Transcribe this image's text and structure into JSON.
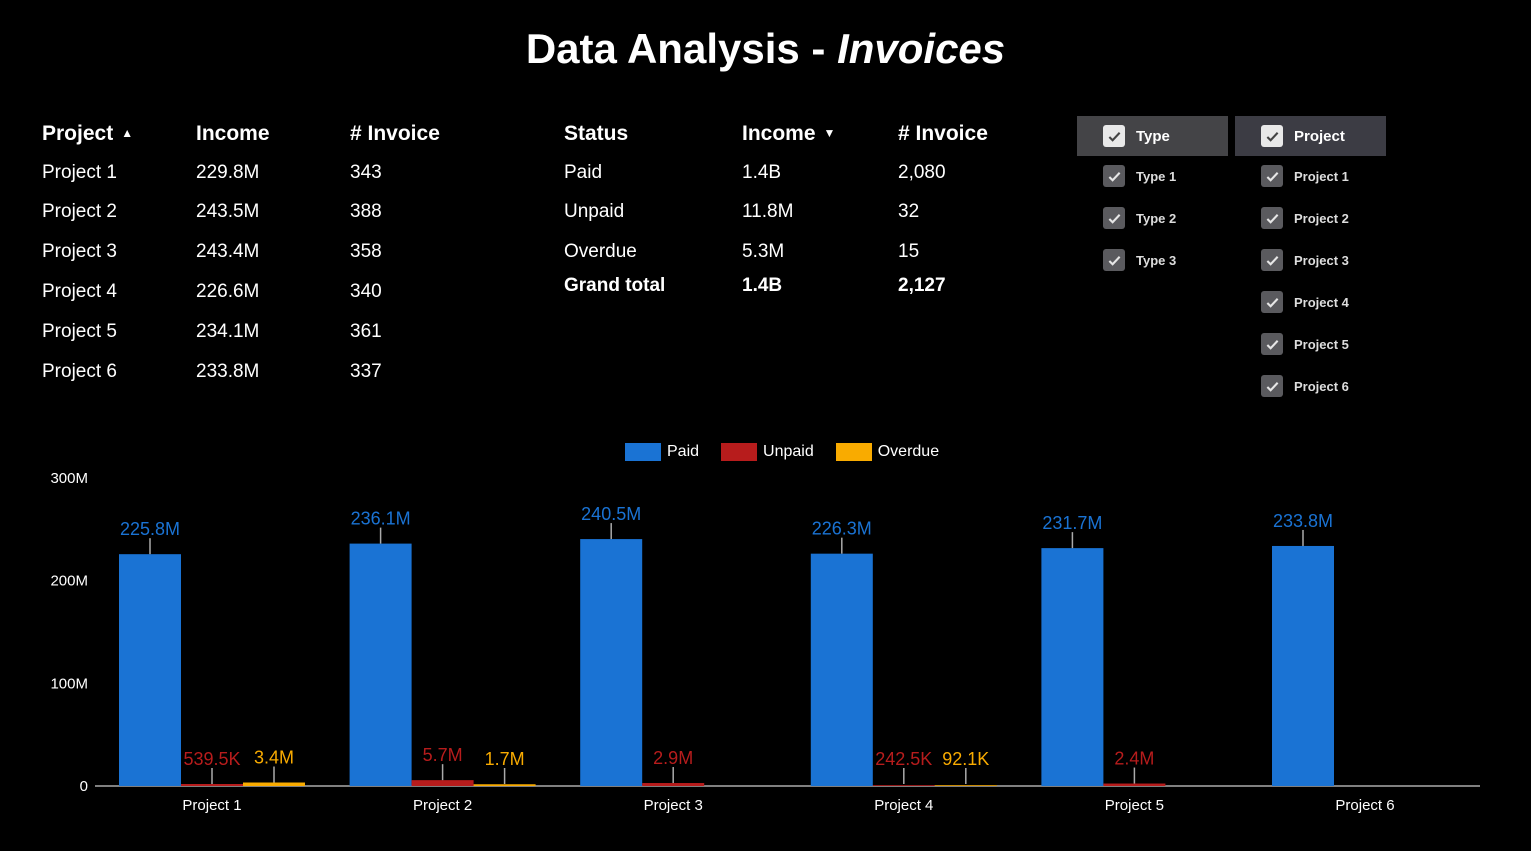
{
  "title": {
    "main": "Data Analysis - ",
    "italic": "Invoices"
  },
  "project_table": {
    "headers": {
      "project": "Project",
      "income": "Income",
      "invoice": "# Invoice"
    },
    "sort_icon": "sort-ascending-icon",
    "rows": [
      {
        "project": "Project 1",
        "income": "229.8M",
        "invoice": "343"
      },
      {
        "project": "Project 2",
        "income": "243.5M",
        "invoice": "388"
      },
      {
        "project": "Project 3",
        "income": "243.4M",
        "invoice": "358"
      },
      {
        "project": "Project 4",
        "income": "226.6M",
        "invoice": "340"
      },
      {
        "project": "Project 5",
        "income": "234.1M",
        "invoice": "361"
      },
      {
        "project": "Project 6",
        "income": "233.8M",
        "invoice": "337"
      }
    ]
  },
  "status_table": {
    "headers": {
      "status": "Status",
      "income": "Income",
      "invoice": "# Invoice"
    },
    "sort_icon": "sort-descending-icon",
    "rows": [
      {
        "status": "Paid",
        "income": "1.4B",
        "invoice": "2,080"
      },
      {
        "status": "Unpaid",
        "income": "11.8M",
        "invoice": "32"
      },
      {
        "status": "Overdue",
        "income": "5.3M",
        "invoice": "15"
      }
    ],
    "total": {
      "status": "Grand total",
      "income": "1.4B",
      "invoice": "2,127"
    }
  },
  "filters": {
    "type": {
      "label": "Type",
      "items": [
        "Type 1",
        "Type 2",
        "Type 3"
      ]
    },
    "project": {
      "label": "Project",
      "items": [
        "Project 1",
        "Project 2",
        "Project 3",
        "Project 4",
        "Project 5",
        "Project 6"
      ]
    }
  },
  "chart_data": {
    "type": "bar",
    "categories": [
      "Project 1",
      "Project 2",
      "Project 3",
      "Project 4",
      "Project 5",
      "Project 6"
    ],
    "series": [
      {
        "name": "Paid",
        "color": "#1a73d4",
        "values": [
          225.8,
          236.1,
          240.5,
          226.3,
          231.7,
          233.8
        ],
        "labels": [
          "225.8M",
          "236.1M",
          "240.5M",
          "226.3M",
          "231.7M",
          "233.8M"
        ]
      },
      {
        "name": "Unpaid",
        "color": "#b71c1c",
        "values": [
          0.5395,
          5.7,
          2.9,
          0.2425,
          2.4,
          null
        ],
        "labels": [
          "539.5K",
          "5.7M",
          "2.9M",
          "242.5K",
          "2.4M",
          null
        ]
      },
      {
        "name": "Overdue",
        "color": "#f9ab00",
        "values": [
          3.4,
          1.7,
          null,
          0.0921,
          null,
          null
        ],
        "labels": [
          "3.4M",
          "1.7M",
          null,
          "92.1K",
          null,
          null
        ]
      }
    ],
    "unit": "M",
    "ylim": [
      0,
      300
    ],
    "yticks": [
      0,
      100,
      200,
      300
    ],
    "ytick_labels": [
      "0",
      "100M",
      "200M",
      "300M"
    ],
    "legend": "top",
    "grid": false
  }
}
